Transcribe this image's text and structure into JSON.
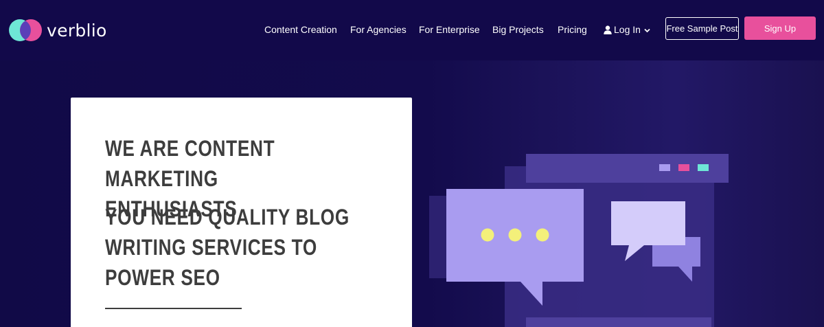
{
  "brand": {
    "name": "verblio"
  },
  "nav": {
    "items": [
      {
        "label": "Content Creation"
      },
      {
        "label": "For Agencies"
      },
      {
        "label": "For Enterprise"
      },
      {
        "label": "Big Projects"
      },
      {
        "label": "Pricing"
      }
    ],
    "login_label": "Log In",
    "free_sample_label": "Free Sample Post",
    "signup_label": "Sign Up"
  },
  "hero": {
    "heading_primary": "We are content marketing enthusiasts",
    "heading_secondary": "You need quality blog writing services to power SEO"
  },
  "colors": {
    "navy": "#12094a",
    "pink": "#e8509c",
    "teal": "#6ee6d6",
    "lavender": "#a99cf0",
    "yellow": "#f3f07a"
  }
}
